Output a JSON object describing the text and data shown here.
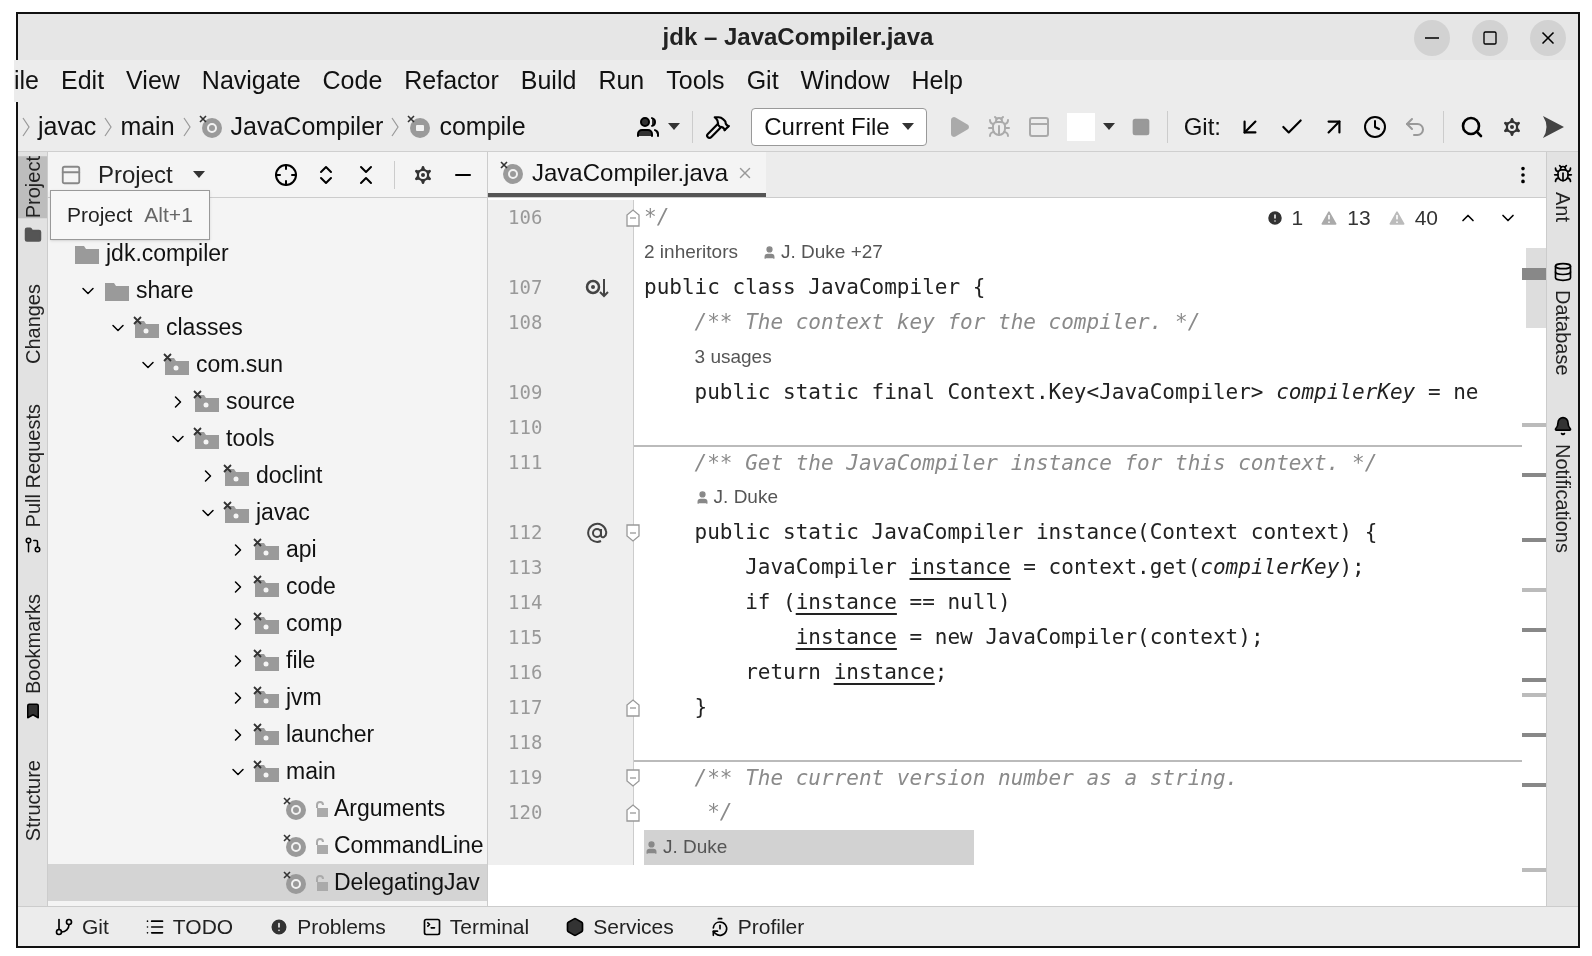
{
  "window": {
    "title": "jdk – JavaCompiler.java"
  },
  "menu": [
    "ile",
    "Edit",
    "View",
    "Navigate",
    "Code",
    "Refactor",
    "Build",
    "Run",
    "Tools",
    "Git",
    "Window",
    "Help"
  ],
  "breadcrumbs": [
    "javac",
    "main",
    "JavaCompiler",
    "compile"
  ],
  "toolbar": {
    "run_config": "Current File",
    "run_enabled": false,
    "git_label": "Git:"
  },
  "left_tabs": [
    {
      "label": "Project",
      "selected": true
    },
    {
      "label": "Changes",
      "selected": false
    },
    {
      "label": "Pull Requests",
      "selected": false
    },
    {
      "label": "Bookmarks",
      "selected": false
    },
    {
      "label": "Structure",
      "selected": false
    }
  ],
  "right_tabs": [
    "Ant",
    "Database",
    "Notifications"
  ],
  "project": {
    "title": "Project",
    "tooltip": {
      "label": "Project",
      "shortcut": "Alt+1"
    },
    "tree": [
      {
        "label": "jdk.compiler",
        "kind": "module",
        "selected": false,
        "children": [
          {
            "label": "share",
            "kind": "folder",
            "expanded": true,
            "selected": false,
            "children": [
              {
                "label": "classes",
                "kind": "package",
                "expanded": true,
                "selected": false,
                "children": [
                  {
                    "label": "com.sun",
                    "kind": "package",
                    "expanded": true,
                    "selected": false,
                    "children": [
                      {
                        "label": "source",
                        "kind": "package",
                        "expanded": false,
                        "selected": false
                      },
                      {
                        "label": "tools",
                        "kind": "package",
                        "expanded": true,
                        "selected": false,
                        "children": [
                          {
                            "label": "doclint",
                            "kind": "package",
                            "expanded": false,
                            "selected": false
                          },
                          {
                            "label": "javac",
                            "kind": "package",
                            "expanded": true,
                            "selected": false,
                            "children": [
                              {
                                "label": "api",
                                "kind": "package",
                                "expanded": false,
                                "selected": false
                              },
                              {
                                "label": "code",
                                "kind": "package",
                                "expanded": false,
                                "selected": false
                              },
                              {
                                "label": "comp",
                                "kind": "package",
                                "expanded": false,
                                "selected": false
                              },
                              {
                                "label": "file",
                                "kind": "package",
                                "expanded": false,
                                "selected": false
                              },
                              {
                                "label": "jvm",
                                "kind": "package",
                                "expanded": false,
                                "selected": false
                              },
                              {
                                "label": "launcher",
                                "kind": "package",
                                "expanded": false,
                                "selected": false
                              },
                              {
                                "label": "main",
                                "kind": "package",
                                "expanded": true,
                                "selected": false,
                                "children": [
                                  {
                                    "label": "Arguments",
                                    "kind": "class",
                                    "selected": false
                                  },
                                  {
                                    "label": "CommandLine",
                                    "kind": "class",
                                    "selected": false
                                  },
                                  {
                                    "label": "DelegatingJav",
                                    "kind": "class",
                                    "selected": true
                                  }
                                ]
                              }
                            ]
                          }
                        ]
                      }
                    ]
                  }
                ]
              }
            ]
          }
        ]
      }
    ]
  },
  "editor": {
    "tab": {
      "label": "JavaCompiler.java",
      "selected": true
    },
    "problems": {
      "errors": "1",
      "warnings": "13",
      "weak_warnings": "40"
    },
    "lines": [
      {
        "kind": "code",
        "number": "106",
        "segments": [
          {
            "text": "*/",
            "kind": "comment"
          }
        ]
      },
      {
        "kind": "hint",
        "items": [
          {
            "text": "2 inheritors",
            "kind": "count"
          },
          {
            "text": "J. Duke +27",
            "kind": "author"
          }
        ],
        "highlighted": false
      },
      {
        "kind": "code",
        "number": "107",
        "segments": [
          {
            "text": "public class JavaCompiler {",
            "kind": "plain"
          }
        ]
      },
      {
        "kind": "code",
        "number": "108",
        "segments": [
          {
            "text": "    /** The context key for the compiler. */",
            "kind": "comment"
          }
        ]
      },
      {
        "kind": "hint",
        "items": [
          {
            "text": "3 usages",
            "kind": "count"
          }
        ],
        "highlighted": false
      },
      {
        "kind": "code",
        "number": "109",
        "segments": [
          {
            "text": "    public static final Context.Key<JavaCompiler> ",
            "kind": "plain"
          },
          {
            "text": "compilerKey",
            "kind": "italic"
          },
          {
            "text": " = ne",
            "kind": "plain"
          }
        ]
      },
      {
        "kind": "code",
        "number": "110"
      },
      {
        "kind": "code",
        "number": "111",
        "separator": true,
        "segments": [
          {
            "text": "    /** Get the JavaCompiler instance for this context. */",
            "kind": "comment"
          }
        ]
      },
      {
        "kind": "hint",
        "items": [
          {
            "text": "J. Duke",
            "kind": "author"
          }
        ],
        "highlighted": false
      },
      {
        "kind": "code",
        "number": "112",
        "segments": [
          {
            "text": "    public static JavaCompiler instance(Context context) {",
            "kind": "plain"
          }
        ]
      },
      {
        "kind": "code",
        "number": "113",
        "segments": [
          {
            "text": "        JavaCompiler ",
            "kind": "plain"
          },
          {
            "text": "instance",
            "kind": "underline"
          },
          {
            "text": " = context.get(",
            "kind": "plain"
          },
          {
            "text": "compilerKey",
            "kind": "italic"
          },
          {
            "text": ");",
            "kind": "plain"
          }
        ]
      },
      {
        "kind": "code",
        "number": "114",
        "segments": [
          {
            "text": "        if (",
            "kind": "plain"
          },
          {
            "text": "instance",
            "kind": "underline"
          },
          {
            "text": " == null)",
            "kind": "plain"
          }
        ]
      },
      {
        "kind": "code",
        "number": "115",
        "segments": [
          {
            "text": "            instance",
            "kind": "underline"
          },
          {
            "text": " = new JavaCompiler(context);",
            "kind": "plain"
          }
        ]
      },
      {
        "kind": "code",
        "number": "116",
        "segments": [
          {
            "text": "        return ",
            "kind": "plain"
          },
          {
            "text": "instance",
            "kind": "underline"
          },
          {
            "text": ";",
            "kind": "plain"
          }
        ]
      },
      {
        "kind": "code",
        "number": "117",
        "segments": [
          {
            "text": "    }",
            "kind": "plain"
          }
        ]
      },
      {
        "kind": "code",
        "number": "118"
      },
      {
        "kind": "code",
        "number": "119",
        "separator": true,
        "segments": [
          {
            "text": "    /** The current version number as a string.",
            "kind": "comment"
          }
        ]
      },
      {
        "kind": "code",
        "number": "120",
        "segments": [
          {
            "text": "     */",
            "kind": "comment"
          }
        ]
      },
      {
        "kind": "hint",
        "items": [
          {
            "text": "J. Duke",
            "kind": "author"
          }
        ],
        "highlighted": true
      }
    ]
  },
  "bottom_tabs": [
    "Git",
    "TODO",
    "Problems",
    "Terminal",
    "Services",
    "Profiler"
  ]
}
